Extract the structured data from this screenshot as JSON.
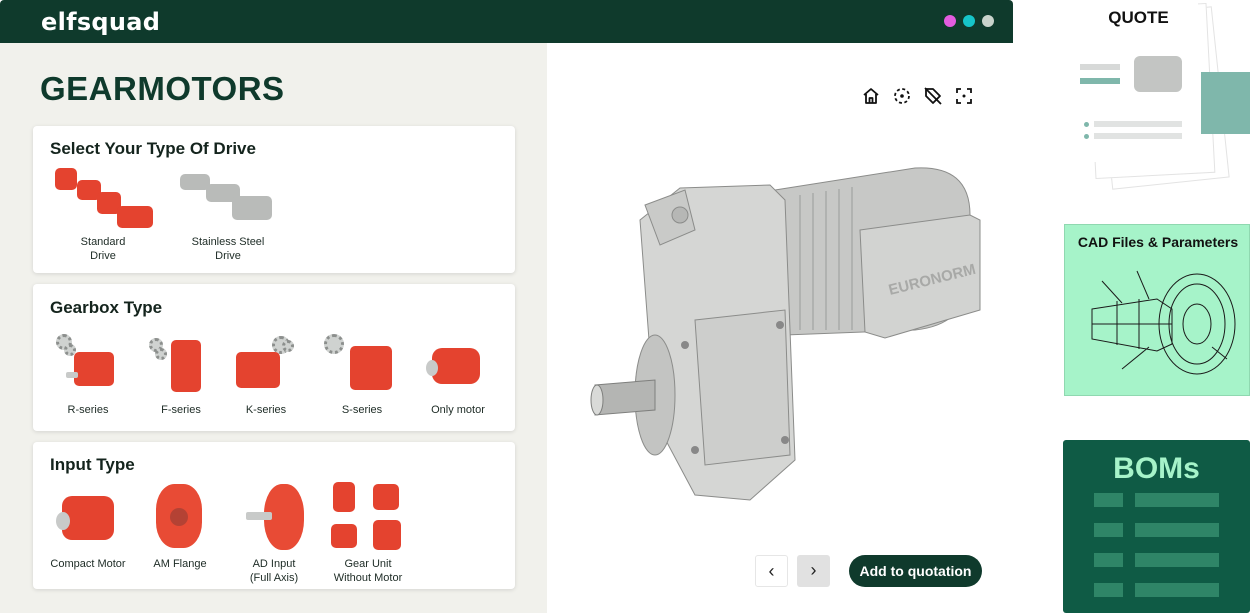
{
  "app": {
    "logo": "elfsquad"
  },
  "colors": {
    "brand_dark": "#0f3a2c",
    "accent_red": "#e4432f",
    "mint": "#a6f3c9",
    "dots": [
      "#e35ce0",
      "#16c5c9",
      "#c9d3cc"
    ]
  },
  "page": {
    "title": "GEARMOTORS"
  },
  "drive": {
    "title": "Select Your Type Of Drive",
    "options": [
      {
        "line1": "Standard",
        "line2": "Drive"
      },
      {
        "line1": "Stainless Steel",
        "line2": "Drive"
      }
    ]
  },
  "gearbox": {
    "title": "Gearbox Type",
    "options": [
      "R-series",
      "F-series",
      "K-series",
      "S-series",
      "Only motor"
    ]
  },
  "input": {
    "title": "Input Type",
    "options": [
      {
        "line1": "Compact Motor",
        "line2": ""
      },
      {
        "line1": "AM Flange",
        "line2": ""
      },
      {
        "line1": "AD Input",
        "line2": "(Full Axis)"
      },
      {
        "line1": "Gear Unit",
        "line2": "Without Motor"
      }
    ]
  },
  "viewer": {
    "icons": [
      "home-icon",
      "focus-icon",
      "tag-off-icon",
      "fullscreen-icon"
    ],
    "model_label": "EURONORM",
    "prev": "‹",
    "next": "›",
    "add_to_quotation": "Add to quotation"
  },
  "panels": {
    "quote_title": "QUOTE",
    "cad_title": "CAD Files & Parameters",
    "boms_title": "BOMs"
  }
}
